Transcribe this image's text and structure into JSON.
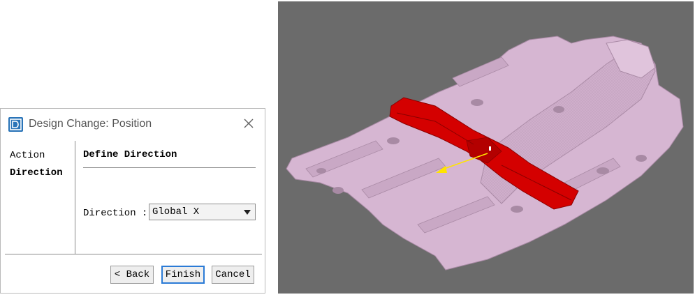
{
  "dialog": {
    "title": "Design Change: Position",
    "steps": [
      "Action",
      "Direction"
    ],
    "section_title": "Define Direction",
    "direction_label": "Direction :",
    "direction_value": "Global X",
    "buttons": {
      "back": "< Back",
      "finish": "Finish",
      "cancel": "Cancel"
    }
  },
  "viewport": {
    "background": "#6b6b6b",
    "part_color": "#d6b6d2",
    "highlight_color": "#d40000",
    "arrow_color": "#ffe400"
  }
}
